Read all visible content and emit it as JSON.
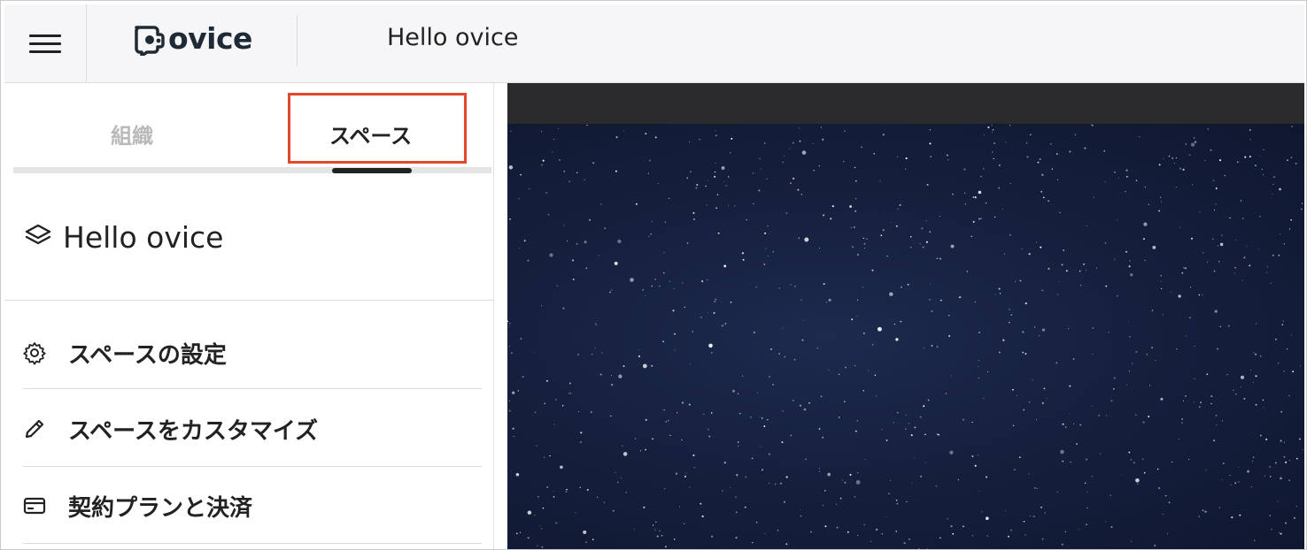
{
  "header": {
    "menu_icon": "hamburger-icon",
    "logo_icon": "ovice-logo-icon",
    "logo_text": "ovice",
    "title": "Hello ovice"
  },
  "sidebar": {
    "tabs": [
      {
        "label": "組織",
        "active": false
      },
      {
        "label": "スペース",
        "active": true
      }
    ],
    "space": {
      "icon": "layers-icon",
      "name": "Hello ovice"
    },
    "menu": [
      {
        "icon": "gear-icon",
        "label": "スペースの設定"
      },
      {
        "icon": "pencil-icon",
        "label": "スペースをカスタマイズ"
      },
      {
        "icon": "credit-card-icon",
        "label": "契約プランと決済"
      }
    ]
  },
  "colors": {
    "highlight": "#e2492c",
    "header_bg": "#f6f6f8",
    "canvas_bg": "#16203e",
    "canvas_top_bar": "#2b2b2d"
  }
}
